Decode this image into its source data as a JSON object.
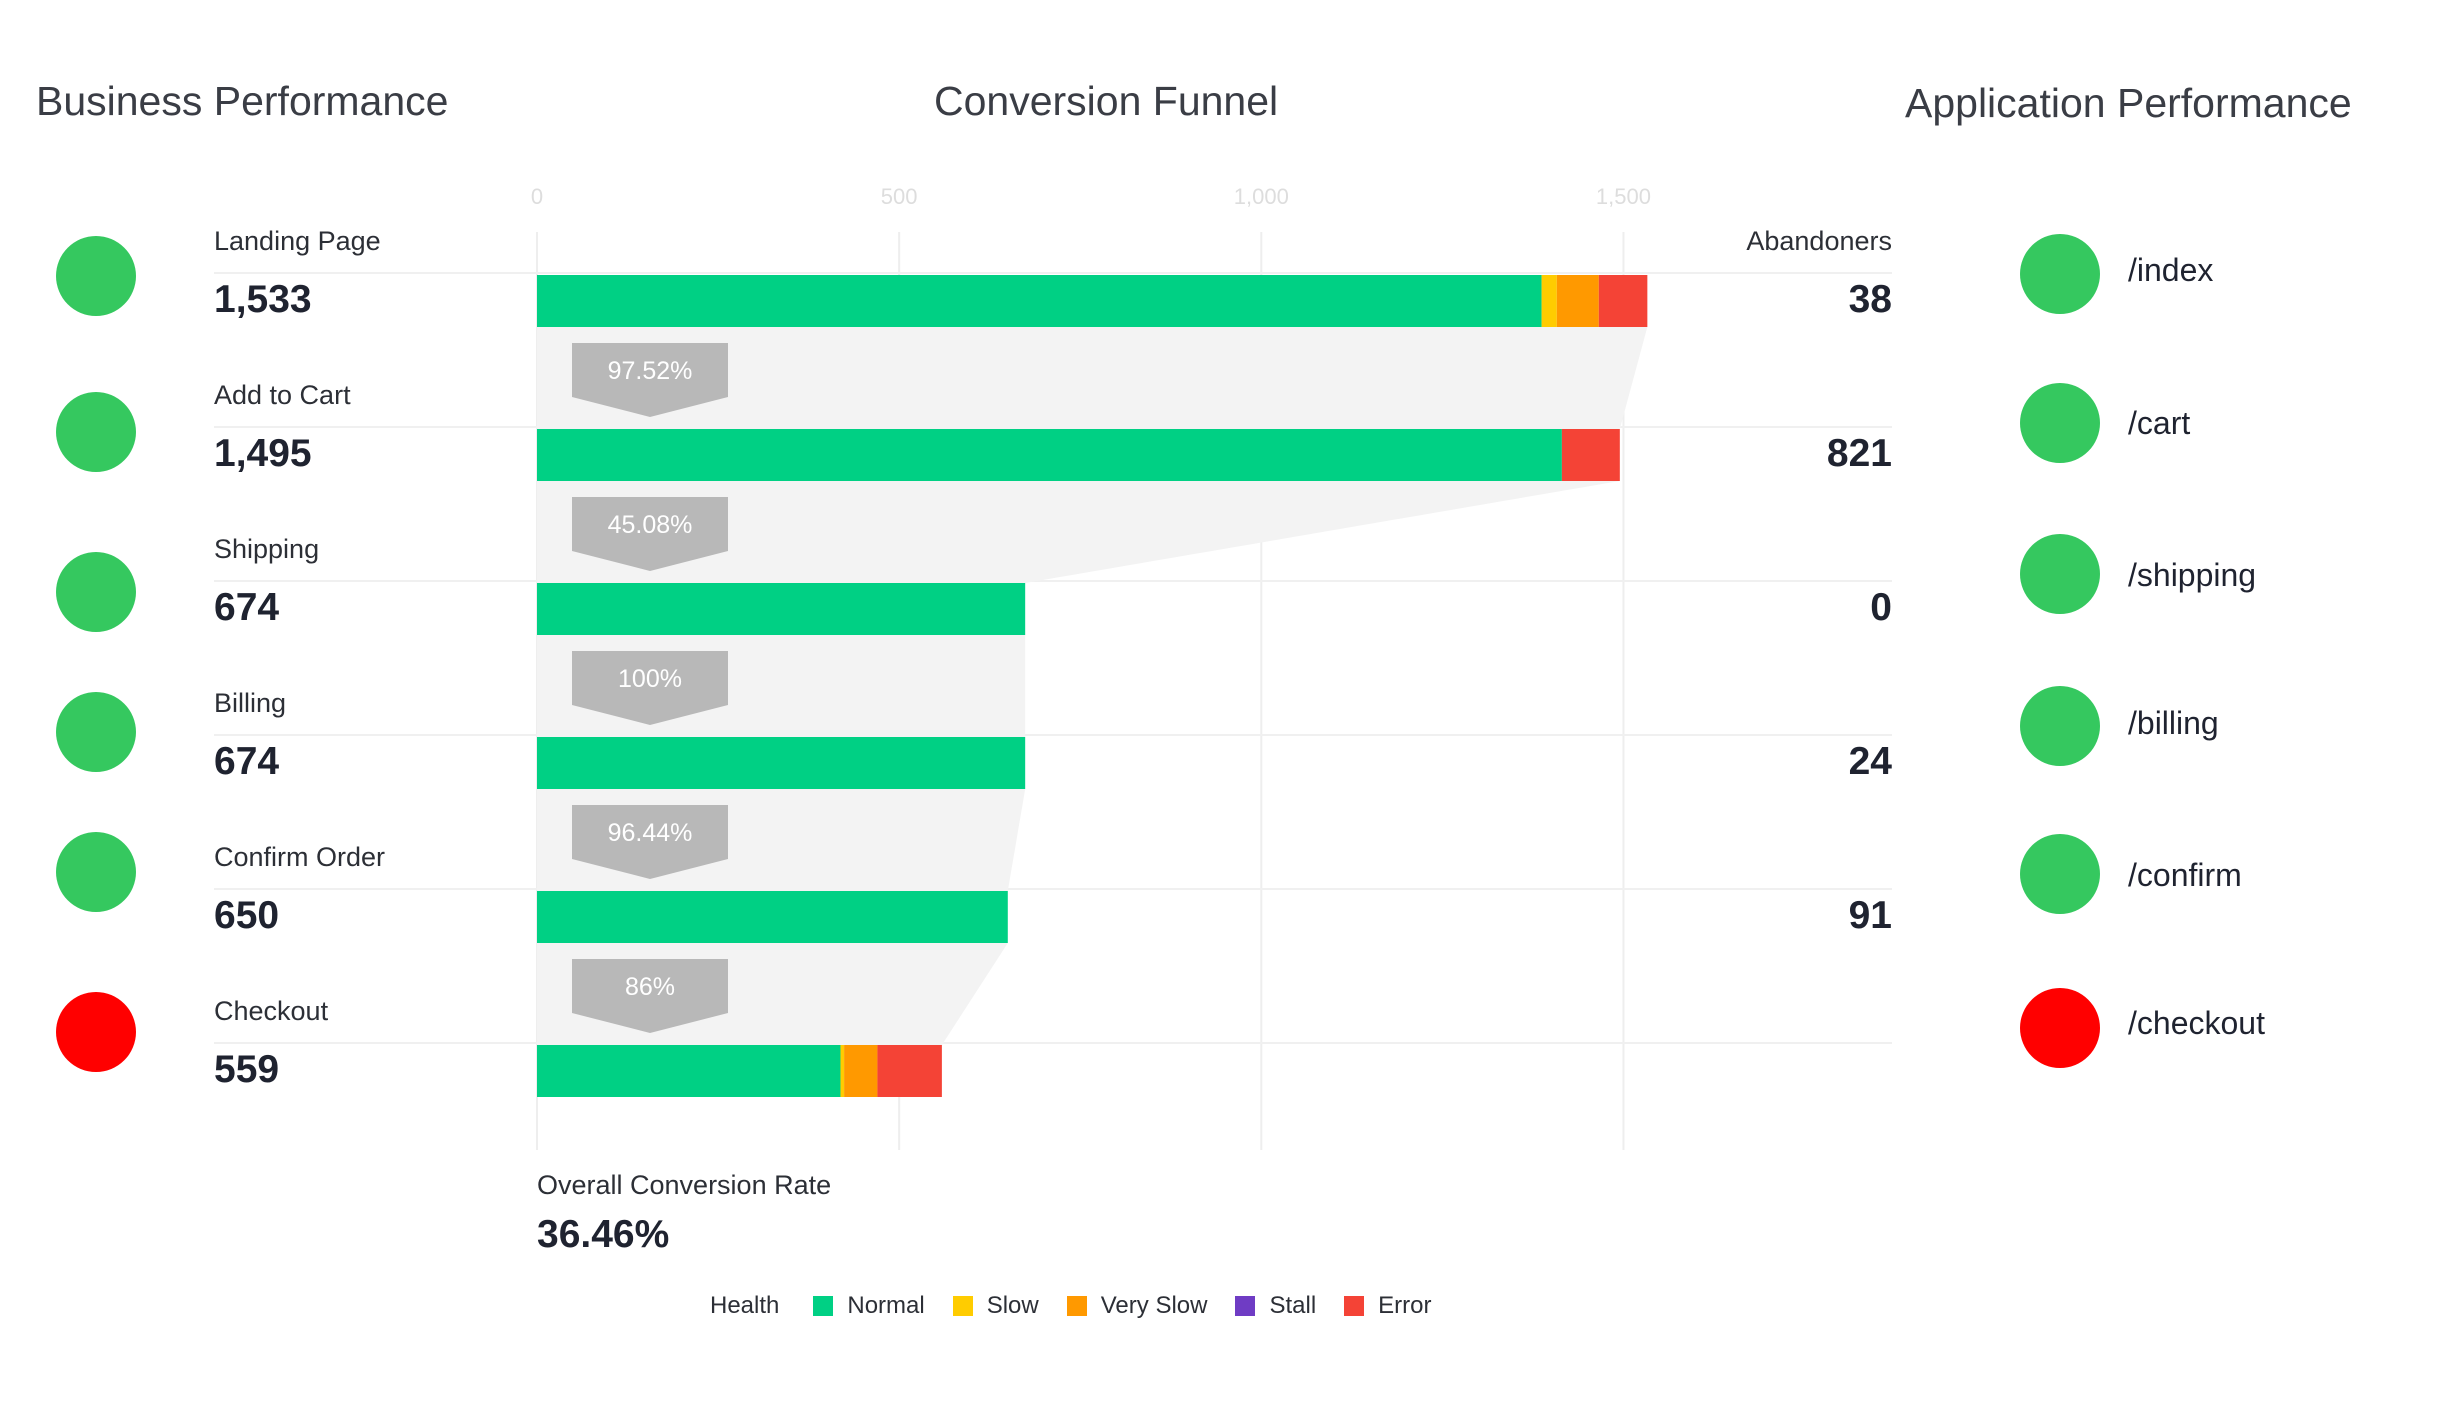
{
  "titles": {
    "business": "Business Performance",
    "funnel": "Conversion Funnel",
    "app": "Application Performance"
  },
  "colors": {
    "normal": "#00d084",
    "slow": "#ffcc00",
    "very_slow": "#ff9900",
    "stall": "#6f3cc4",
    "error": "#f44336",
    "healthy_dot": "#35c85f",
    "bad_dot": "#ff0000",
    "connector": "#f3f3f3",
    "badge": "#b8b8b8",
    "grid": "#eeeeee",
    "axis_text": "#dddddd"
  },
  "abandoners_header": "Abandoners",
  "stages": [
    {
      "label": "Landing Page",
      "count": "1,533",
      "abandoners": "38",
      "status": "healthy"
    },
    {
      "label": "Add to Cart",
      "count": "1,495",
      "abandoners": "821",
      "status": "healthy"
    },
    {
      "label": "Shipping",
      "count": "674",
      "abandoners": "0",
      "status": "healthy"
    },
    {
      "label": "Billing",
      "count": "674",
      "abandoners": "24",
      "status": "healthy"
    },
    {
      "label": "Confirm Order",
      "count": "650",
      "abandoners": "91",
      "status": "healthy"
    },
    {
      "label": "Checkout",
      "count": "559",
      "abandoners": "",
      "status": "bad"
    }
  ],
  "app_pages": [
    {
      "label": "/index",
      "status": "healthy"
    },
    {
      "label": "/cart",
      "status": "healthy"
    },
    {
      "label": "/shipping",
      "status": "healthy"
    },
    {
      "label": "/billing",
      "status": "healthy"
    },
    {
      "label": "/confirm",
      "status": "healthy"
    },
    {
      "label": "/checkout",
      "status": "bad"
    }
  ],
  "overall": {
    "label": "Overall Conversion Rate",
    "value": "36.46%"
  },
  "legend": {
    "title": "Health",
    "items": [
      {
        "key": "normal",
        "label": "Normal"
      },
      {
        "key": "slow",
        "label": "Slow"
      },
      {
        "key": "very_slow",
        "label": "Very Slow"
      },
      {
        "key": "stall",
        "label": "Stall"
      },
      {
        "key": "error",
        "label": "Error"
      }
    ]
  },
  "chart_data": {
    "type": "bar",
    "orientation": "horizontal",
    "title": "Conversion Funnel",
    "categories": [
      "Landing Page",
      "Add to Cart",
      "Shipping",
      "Billing",
      "Confirm Order",
      "Checkout"
    ],
    "xlim": [
      0,
      1600
    ],
    "x_ticks": [
      0,
      500,
      1000,
      1500
    ],
    "x_tick_labels": [
      "0",
      "500",
      "1,000",
      "1,500"
    ],
    "grid": true,
    "stacked": true,
    "series": [
      {
        "name": "Normal",
        "key": "normal",
        "values": [
          1387,
          1415,
          674,
          674,
          650,
          419
        ]
      },
      {
        "name": "Slow",
        "key": "slow",
        "values": [
          21,
          0,
          0,
          0,
          0,
          5
        ]
      },
      {
        "name": "Very Slow",
        "key": "very_slow",
        "values": [
          58,
          0,
          0,
          0,
          0,
          46
        ]
      },
      {
        "name": "Stall",
        "key": "stall",
        "values": [
          0,
          0,
          0,
          0,
          0,
          0
        ]
      },
      {
        "name": "Error",
        "key": "error",
        "values": [
          67,
          80,
          0,
          0,
          0,
          89
        ]
      }
    ],
    "totals": [
      1533,
      1495,
      674,
      674,
      650,
      559
    ],
    "conversion_rates": [
      "97.52%",
      "45.08%",
      "100%",
      "96.44%",
      "86%"
    ]
  }
}
